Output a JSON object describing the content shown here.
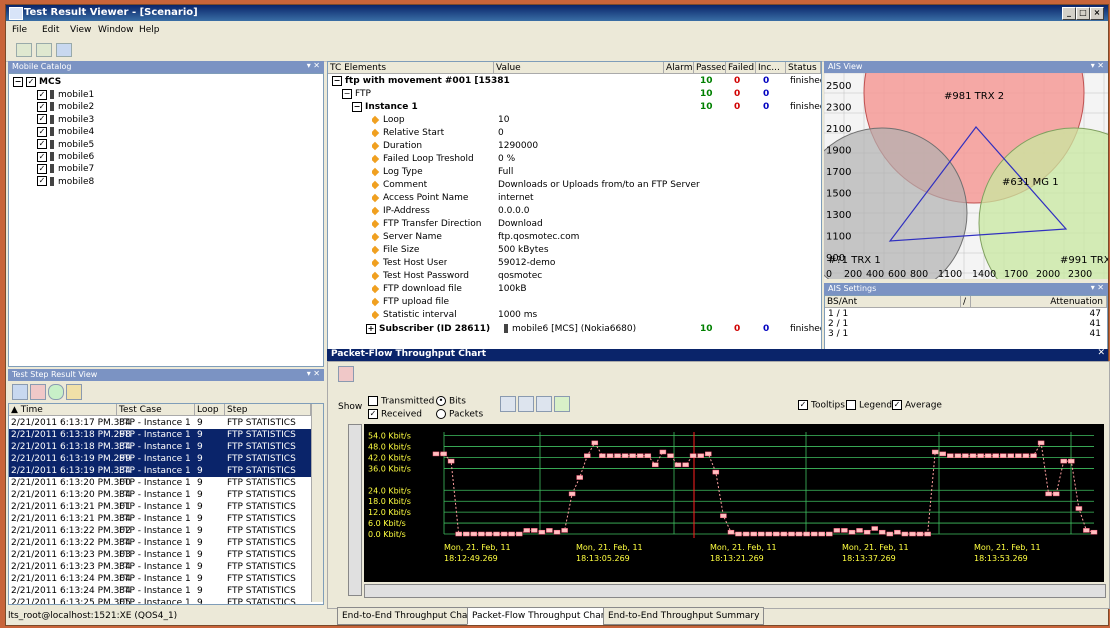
{
  "window": {
    "title": "Test Result Viewer - [Scenario]"
  },
  "menu": [
    "File",
    "Edit",
    "View",
    "Window",
    "Help"
  ],
  "mobile_catalog": {
    "title": "Mobile Catalog",
    "root": "MCS",
    "items": [
      "mobile1",
      "mobile2",
      "mobile3",
      "mobile4",
      "mobile5",
      "mobile6",
      "mobile7",
      "mobile8"
    ]
  },
  "tc_tree": {
    "headers": [
      "TC Elements",
      "Value",
      "Alarm",
      "Passed",
      "Failed",
      "Inc...",
      "Status"
    ],
    "root": {
      "label": "ftp with movement #001 [15381",
      "passed": "10",
      "failed": "0",
      "inc": "0",
      "status": "finished"
    },
    "ftp": {
      "label": "FTP",
      "passed": "10",
      "failed": "0",
      "inc": "0"
    },
    "instance": {
      "label": "Instance 1",
      "passed": "10",
      "failed": "0",
      "inc": "0",
      "status": "finished"
    },
    "params": [
      {
        "k": "Loop",
        "v": "10"
      },
      {
        "k": "Relative Start",
        "v": "0"
      },
      {
        "k": "Duration",
        "v": "1290000"
      },
      {
        "k": "Failed Loop Treshold",
        "v": "0 %"
      },
      {
        "k": "Log Type",
        "v": "Full"
      },
      {
        "k": "Comment",
        "v": "Downloads or Uploads from/to an FTP Server"
      },
      {
        "k": "Access Point Name",
        "v": "internet"
      },
      {
        "k": "IP-Address",
        "v": "0.0.0.0"
      },
      {
        "k": "FTP Transfer Direction",
        "v": "Download"
      },
      {
        "k": "Server Name",
        "v": "ftp.qosmotec.com"
      },
      {
        "k": "File Size",
        "v": "500 kBytes"
      },
      {
        "k": "Test Host User",
        "v": "59012-demo"
      },
      {
        "k": "Test Host Password",
        "v": "qosmotec"
      },
      {
        "k": "FTP download file",
        "v": "100kB"
      },
      {
        "k": "FTP upload file",
        "v": ""
      },
      {
        "k": "Statistic interval",
        "v": "1000 ms"
      }
    ],
    "subscriber": {
      "label": "Subscriber (ID 28611)",
      "value": "mobile6 [MCS] (Nokia6680)",
      "passed": "10",
      "failed": "0",
      "inc": "0",
      "status": "finished"
    }
  },
  "ais_view": {
    "title": "AIS View",
    "y_ticks": [
      "2500",
      "2300",
      "2100",
      "1900",
      "1700",
      "1500",
      "1300",
      "1100",
      "900"
    ],
    "x_ticks": [
      "0",
      "200",
      "400",
      "600",
      "800",
      "1100",
      "1400",
      "1700",
      "2000",
      "2300"
    ],
    "labels": [
      "#981 TRX 2",
      "#631 MG 1",
      "#?1 TRX 1",
      "#991 TRX 3"
    ],
    "colors": {
      "red": "#f4a0a0",
      "gray": "#b8b8b8",
      "green": "#c8e8a0",
      "blue": "#3030c0"
    }
  },
  "ais_settings": {
    "title": "AIS Settings",
    "headers": [
      "BS/Ant",
      "/",
      "Attenuation"
    ],
    "rows": [
      [
        "1 / 1",
        "47"
      ],
      [
        "2 / 1",
        "41"
      ],
      [
        "3 / 1",
        "41"
      ]
    ]
  },
  "step_view": {
    "title": "Test Step Result View",
    "headers": [
      "Time",
      "Test Case",
      "Loop",
      "Step"
    ],
    "rows": [
      {
        "time": "2/21/2011 6:13:17 PM.334",
        "tc": "FTP - Instance 1",
        "loop": "9",
        "step": "FTP STATISTICS",
        "sel": false
      },
      {
        "time": "2/21/2011 6:13:18 PM.298",
        "tc": "FTP - Instance 1",
        "loop": "9",
        "step": "FTP STATISTICS",
        "sel": true
      },
      {
        "time": "2/21/2011 6:13:18 PM.334",
        "tc": "FTP - Instance 1",
        "loop": "9",
        "step": "FTP STATISTICS",
        "sel": true
      },
      {
        "time": "2/21/2011 6:13:19 PM.299",
        "tc": "FTP - Instance 1",
        "loop": "9",
        "step": "FTP STATISTICS",
        "sel": true
      },
      {
        "time": "2/21/2011 6:13:19 PM.334",
        "tc": "FTP - Instance 1",
        "loop": "9",
        "step": "FTP STATISTICS",
        "sel": true
      },
      {
        "time": "2/21/2011 6:13:20 PM.300",
        "tc": "FTP - Instance 1",
        "loop": "9",
        "step": "FTP STATISTICS",
        "sel": false
      },
      {
        "time": "2/21/2011 6:13:20 PM.334",
        "tc": "FTP - Instance 1",
        "loop": "9",
        "step": "FTP STATISTICS",
        "sel": false
      },
      {
        "time": "2/21/2011 6:13:21 PM.301",
        "tc": "FTP - Instance 1",
        "loop": "9",
        "step": "FTP STATISTICS",
        "sel": false
      },
      {
        "time": "2/21/2011 6:13:21 PM.334",
        "tc": "FTP - Instance 1",
        "loop": "9",
        "step": "FTP STATISTICS",
        "sel": false
      },
      {
        "time": "2/21/2011 6:13:22 PM.302",
        "tc": "FTP - Instance 1",
        "loop": "9",
        "step": "FTP STATISTICS",
        "sel": false
      },
      {
        "time": "2/21/2011 6:13:22 PM.334",
        "tc": "FTP - Instance 1",
        "loop": "9",
        "step": "FTP STATISTICS",
        "sel": false
      },
      {
        "time": "2/21/2011 6:13:23 PM.303",
        "tc": "FTP - Instance 1",
        "loop": "9",
        "step": "FTP STATISTICS",
        "sel": false
      },
      {
        "time": "2/21/2011 6:13:23 PM.334",
        "tc": "FTP - Instance 1",
        "loop": "9",
        "step": "FTP STATISTICS",
        "sel": false
      },
      {
        "time": "2/21/2011 6:13:24 PM.304",
        "tc": "FTP - Instance 1",
        "loop": "9",
        "step": "FTP STATISTICS",
        "sel": false
      },
      {
        "time": "2/21/2011 6:13:24 PM.334",
        "tc": "FTP - Instance 1",
        "loop": "9",
        "step": "FTP STATISTICS",
        "sel": false
      },
      {
        "time": "2/21/2011 6:13:25 PM.305",
        "tc": "FTP - Instance 1",
        "loop": "9",
        "step": "FTP STATISTICS",
        "sel": false
      }
    ]
  },
  "throughput": {
    "title": "Packet-Flow Throughput Chart",
    "show_label": "Show",
    "options": {
      "transmitted": "Transmitted",
      "received": "Received",
      "bits": "Bits",
      "packets": "Packets",
      "tooltips": "Tooltips",
      "legend": "Legend",
      "average": "Average"
    },
    "tabs": [
      "End-to-End Throughput Chart",
      "Packet-Flow Throughput Chart",
      "End-to-End Throughput Summary"
    ]
  },
  "chart_data": {
    "type": "line",
    "y_ticks": [
      "54.0 Kbit/s",
      "48.0 Kbit/s",
      "42.0 Kbit/s",
      "36.0 Kbit/s",
      "24.0 Kbit/s",
      "18.0 Kbit/s",
      "12.0 Kbit/s",
      "6.0 Kbit/s",
      "0.0 Kbit/s"
    ],
    "x_labels": [
      {
        "d": "Mon, 21. Feb, 11",
        "t": "18:12:49.269"
      },
      {
        "d": "Mon, 21. Feb, 11",
        "t": "18:13:05.269"
      },
      {
        "d": "Mon, 21. Feb, 11",
        "t": "18:13:21.269"
      },
      {
        "d": "Mon, 21. Feb, 11",
        "t": "18:13:37.269"
      },
      {
        "d": "Mon, 21. Feb, 11",
        "t": "18:13:53.269"
      }
    ],
    "ylim": [
      0,
      56
    ],
    "series": [
      {
        "name": "Received",
        "values": [
          44,
          44,
          40,
          0,
          0,
          0,
          0,
          0,
          0,
          0,
          0,
          0,
          2,
          2,
          1,
          2,
          1,
          2,
          22,
          31,
          43,
          50,
          43,
          43,
          43,
          43,
          43,
          43,
          43,
          38,
          45,
          43,
          38,
          38,
          43,
          43,
          44,
          34,
          10,
          1,
          0,
          0,
          0,
          0,
          0,
          0,
          0,
          0,
          0,
          0,
          0,
          0,
          0,
          2,
          2,
          1,
          2,
          1,
          3,
          1,
          0,
          1,
          0,
          0,
          0,
          0,
          45,
          44,
          43,
          43,
          43,
          43,
          43,
          43,
          43,
          43,
          43,
          43,
          43,
          43,
          50,
          22,
          22,
          40,
          40,
          14,
          2,
          1
        ]
      }
    ],
    "colors": {
      "line": "#ffa0a0",
      "marker": "#ffc0c0",
      "grid": "#3fbf60",
      "cursor": "#ff2020"
    }
  },
  "status_bar": {
    "text": "lts_root@localhost:1521:XE (QOS4_1)"
  }
}
